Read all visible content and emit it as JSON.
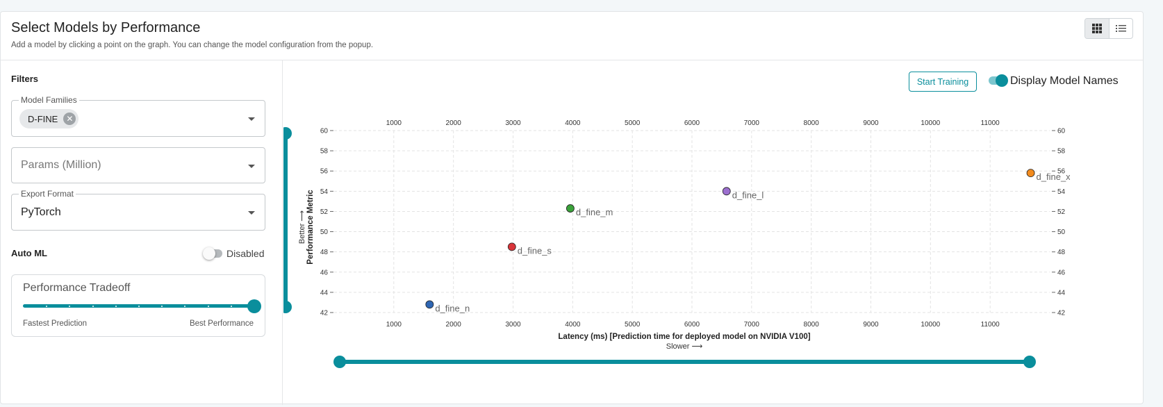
{
  "header": {
    "title": "Select Models by Performance",
    "subtitle": "Add a model by clicking a point on the graph. You can change the model configuration from the popup."
  },
  "view_toggle": {
    "selected": "grid",
    "options": [
      "grid-icon",
      "list-icon"
    ]
  },
  "filters": {
    "label": "Filters",
    "model_families": {
      "legend": "Model Families",
      "chips": [
        "D-FINE"
      ]
    },
    "params": {
      "placeholder": "Params (Million)"
    },
    "export_format": {
      "legend": "Export Format",
      "value": "PyTorch"
    }
  },
  "auto_ml": {
    "label": "Auto ML",
    "state": "Disabled",
    "enabled": false
  },
  "tradeoff": {
    "title": "Performance Tradeoff",
    "min_label": "Fastest Prediction",
    "max_label": "Best Performance",
    "value": 1.0
  },
  "toolbar": {
    "start_training": "Start Training",
    "display_names_label": "Display Model Names",
    "display_names_on": true
  },
  "colors": {
    "accent": "#0a8e9c"
  },
  "chart_data": {
    "type": "scatter",
    "xlabel": "Latency (ms) [Prediction time for deployed model on NVIDIA V100]",
    "xlabel_hint": "Slower ⟶",
    "ylabel": "Performance Metric",
    "ylabel_hint": "Better ⟶",
    "xlim": [
      0,
      12000
    ],
    "ylim": [
      42,
      60
    ],
    "xticks": [
      1000,
      2000,
      3000,
      4000,
      5000,
      6000,
      7000,
      8000,
      9000,
      10000,
      11000
    ],
    "yticks": [
      42,
      44,
      46,
      48,
      50,
      52,
      54,
      56,
      58,
      60
    ],
    "grid": true,
    "points": [
      {
        "name": "d_fine_n",
        "x": 1600,
        "y": 42.8,
        "color": "#2f66b3"
      },
      {
        "name": "d_fine_s",
        "x": 2980,
        "y": 48.5,
        "color": "#d9343a"
      },
      {
        "name": "d_fine_m",
        "x": 3960,
        "y": 52.3,
        "color": "#3aa23a"
      },
      {
        "name": "d_fine_l",
        "x": 6580,
        "y": 54.0,
        "color": "#9c6fcf"
      },
      {
        "name": "d_fine_x",
        "x": 11680,
        "y": 55.8,
        "color": "#f28b1e"
      }
    ],
    "y_range_slider": [
      42,
      60
    ],
    "x_range_slider": [
      0,
      12000
    ]
  }
}
